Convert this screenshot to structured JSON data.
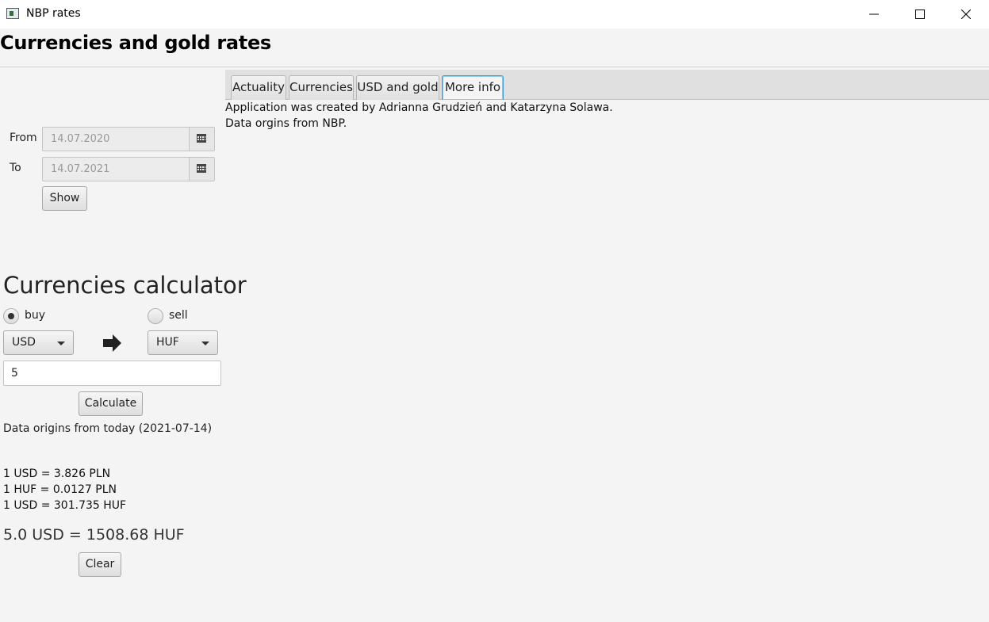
{
  "window": {
    "title": "NBP rates"
  },
  "header": {
    "title": "Currencies and gold rates"
  },
  "range": {
    "from_label": "From",
    "from_value": "14.07.2020",
    "to_label": "To",
    "to_value": "14.07.2021",
    "show_label": "Show"
  },
  "calculator": {
    "title": "Currencies calculator",
    "buy_label": "buy",
    "sell_label": "sell",
    "selected_mode": "buy",
    "from_currency": "USD",
    "to_currency": "HUF",
    "amount": "5",
    "calculate_label": "Calculate",
    "data_note": "Data origins from today (2021-07-14)",
    "rates": [
      "1 USD = 3.826 PLN",
      "1 HUF = 0.0127 PLN",
      "1 USD = 301.735 HUF"
    ],
    "result": "5.0 USD = 1508.68 HUF",
    "clear_label": "Clear"
  },
  "tabs": [
    {
      "label": "Actuality"
    },
    {
      "label": "Currencies"
    },
    {
      "label": "USD and gold"
    },
    {
      "label": "More info"
    }
  ],
  "more_info": {
    "line1": "Application was created by Adrianna Grudzień and Katarzyna Solawa.",
    "line2": "Data orgins from NBP."
  },
  "colors": {
    "active_tab_border": "#3b9bd8"
  }
}
